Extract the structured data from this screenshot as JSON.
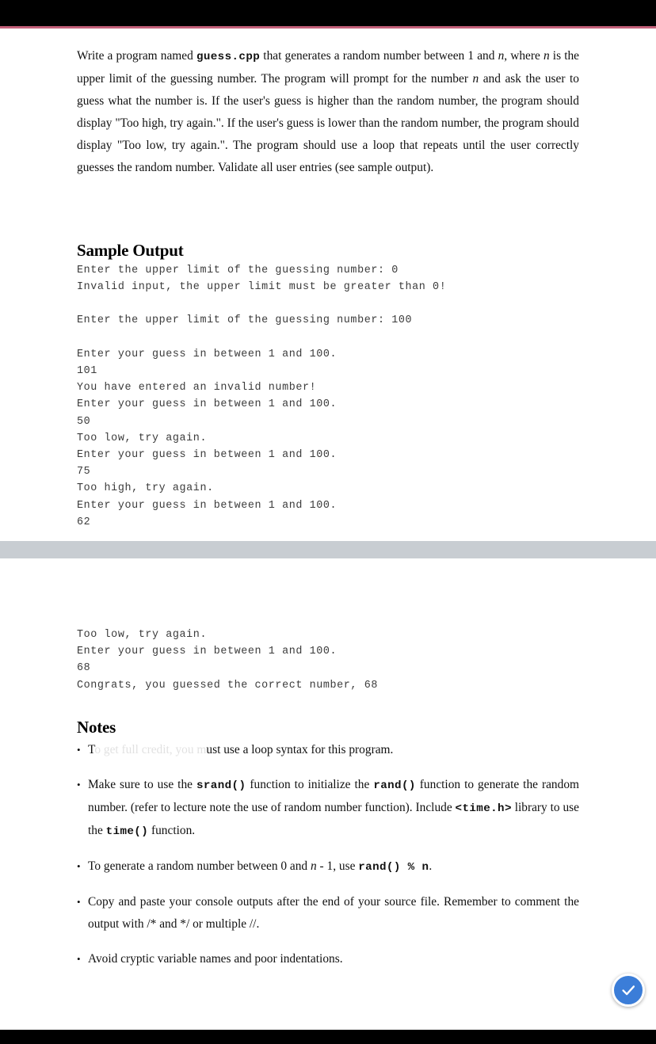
{
  "window": {
    "topbar_color": "#000000",
    "accent_color": "#c4607a",
    "bottombar_color": "#000000",
    "page_gap_color": "#c8cdd2"
  },
  "assignment": {
    "intro_segments": [
      {
        "type": "text",
        "value": "Write a program named "
      },
      {
        "type": "mono",
        "value": "guess.cpp"
      },
      {
        "type": "text",
        "value": " that generates a random number between 1 and "
      },
      {
        "type": "italic",
        "value": "n"
      },
      {
        "type": "text",
        "value": ", where "
      },
      {
        "type": "italic",
        "value": "n"
      },
      {
        "type": "text",
        "value": " is the upper limit of the guessing number.  The program will prompt for the number "
      },
      {
        "type": "italic",
        "value": "n"
      },
      {
        "type": "text",
        "value": " and ask the user to guess what the number is.  If the user's guess is higher than the random number, the program should display \"Too high, try again.\".  If the user's guess is lower than the random number, the program should display \"Too low, try again.\".  The program should use a loop that repeats until the user correctly guesses the random number.  Validate all user entries (see sample output)."
      }
    ]
  },
  "sample_output": {
    "heading": "Sample Output",
    "lines_page1": [
      "Enter the upper limit of the guessing number: 0",
      "Invalid input, the upper limit must be greater than 0!",
      "",
      "Enter the upper limit of the guessing number: 100",
      "",
      "Enter your guess in between 1 and 100.",
      "101",
      "You have entered an invalid number!",
      "Enter your guess in between 1 and 100.",
      "50",
      "Too low, try again.",
      "Enter your guess in between 1 and 100.",
      "75",
      "Too high, try again.",
      "Enter your guess in between 1 and 100.",
      "62"
    ],
    "lines_page2": [
      "Too low, try again.",
      "Enter your guess in between 1 and 100.",
      "68",
      "Congrats, you guessed the correct number, 68"
    ]
  },
  "notes": {
    "heading": "Notes",
    "items": [
      {
        "id": "note-loop-syntax",
        "faded": true,
        "visible_prefix": "T",
        "faded_text": "o get full credit, you m",
        "visible_suffix": "ust use a loop syntax for this program."
      },
      {
        "id": "note-srand",
        "faded": false,
        "segments": [
          {
            "type": "text",
            "value": "Make sure to use the "
          },
          {
            "type": "mono",
            "value": "srand()"
          },
          {
            "type": "text",
            "value": " function to initialize the "
          },
          {
            "type": "mono",
            "value": "rand()"
          },
          {
            "type": "text",
            "value": " function to generate the random number.  (refer to lecture note the use of random number function).  Include "
          },
          {
            "type": "mono",
            "value": "<time.h>"
          },
          {
            "type": "text",
            "value": " library to use the "
          },
          {
            "type": "mono",
            "value": "time()"
          },
          {
            "type": "text",
            "value": " function."
          }
        ]
      },
      {
        "id": "note-modulo",
        "faded": false,
        "segments": [
          {
            "type": "text",
            "value": "To generate a random number between 0 and "
          },
          {
            "type": "italic",
            "value": "n"
          },
          {
            "type": "text",
            "value": " - 1,  use "
          },
          {
            "type": "mono",
            "value": "rand() % n"
          },
          {
            "type": "text",
            "value": "."
          }
        ]
      },
      {
        "id": "note-copy-paste",
        "faded": false,
        "segments": [
          {
            "type": "text",
            "value": "Copy and paste your console outputs after the end of your source file.  Remember to comment the output with /* and */ or multiple //."
          }
        ]
      },
      {
        "id": "note-cryptic-names",
        "faded": false,
        "segments": [
          {
            "type": "text",
            "value": "Avoid cryptic variable names and poor indentations."
          }
        ]
      }
    ]
  },
  "fab": {
    "icon": "check-icon",
    "color": "#3b7dd8",
    "label": "Done"
  }
}
